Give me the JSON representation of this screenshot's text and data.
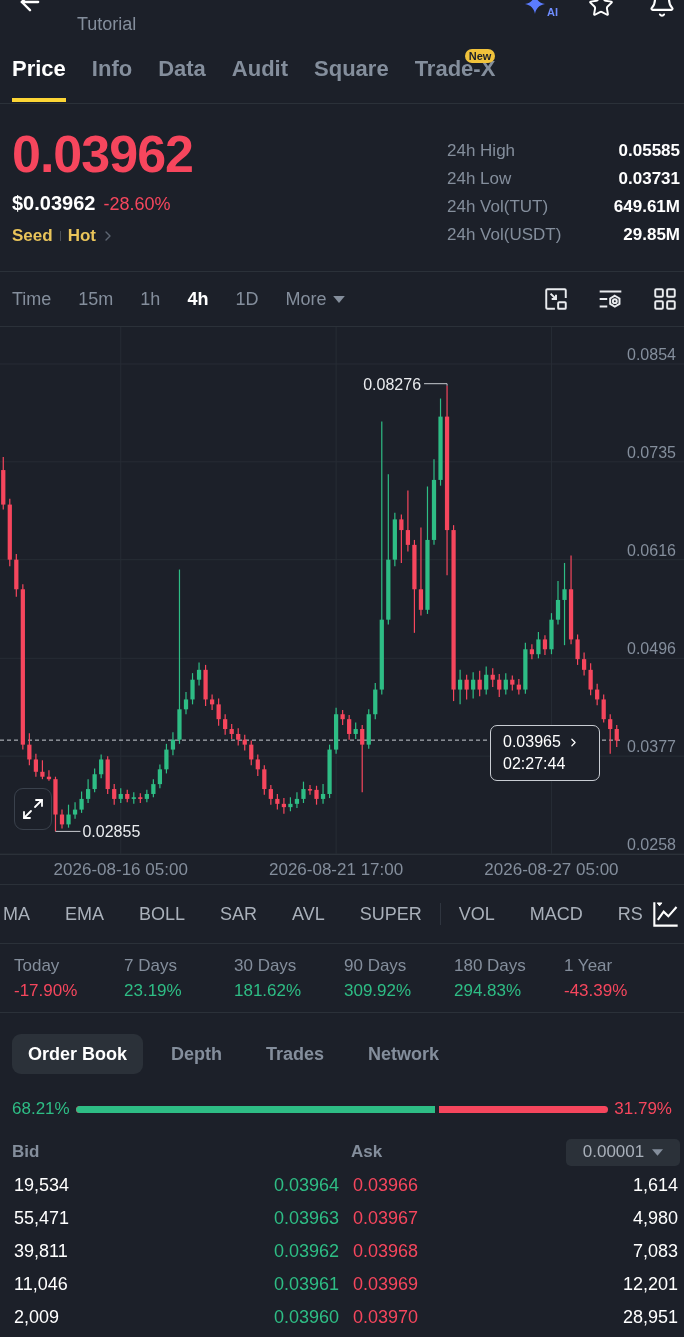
{
  "header": {
    "subtitle": "Tutorial",
    "ai_badge": "AI"
  },
  "tabs": [
    {
      "label": "Price",
      "selected": true
    },
    {
      "label": "Info",
      "selected": false
    },
    {
      "label": "Data",
      "selected": false
    },
    {
      "label": "Audit",
      "selected": false
    },
    {
      "label": "Square",
      "selected": false
    },
    {
      "label": "Trade-X",
      "selected": false,
      "badge": "New"
    }
  ],
  "price": {
    "last": "0.03962",
    "usd": "$0.03962",
    "change": "-28.60%",
    "tags": [
      "Seed",
      "Hot"
    ]
  },
  "stats": [
    {
      "label": "24h High",
      "value": "0.05585"
    },
    {
      "label": "24h Low",
      "value": "0.03731"
    },
    {
      "label": "24h Vol(TUT)",
      "value": "649.61M"
    },
    {
      "label": "24h Vol(USDT)",
      "value": "29.85M"
    }
  ],
  "intervals": [
    {
      "label": "Time",
      "selected": false,
      "kind": "option"
    },
    {
      "label": "15m",
      "selected": false,
      "kind": "option"
    },
    {
      "label": "1h",
      "selected": false,
      "kind": "option"
    },
    {
      "label": "4h",
      "selected": true,
      "kind": "option"
    },
    {
      "label": "1D",
      "selected": false,
      "kind": "option"
    },
    {
      "label": "More",
      "selected": false,
      "kind": "dropdown"
    }
  ],
  "chart": {
    "chart_data": {
      "type": "candlestick",
      "categories": [
        null,
        null,
        null,
        null,
        null,
        null,
        null,
        null,
        null,
        null,
        null,
        null,
        null,
        null,
        null,
        null,
        null,
        null,
        "2026-08-16 05:00",
        null,
        null,
        null,
        null,
        null,
        null,
        null,
        null,
        null,
        null,
        null,
        null,
        null,
        null,
        null,
        null,
        null,
        null,
        null,
        null,
        null,
        null,
        null,
        null,
        null,
        null,
        null,
        null,
        null,
        null,
        null,
        null,
        "2026-08-21 17:00",
        null,
        null,
        null,
        null,
        null,
        null,
        null,
        null,
        null,
        null,
        null,
        null,
        null,
        null,
        null,
        null,
        null,
        null,
        null,
        null,
        null,
        null,
        null,
        null,
        null,
        null,
        null,
        null,
        null,
        null,
        null,
        null,
        "2026-08-27 05:00",
        null,
        null,
        null,
        null,
        null,
        null,
        null,
        null,
        null,
        null
      ],
      "ohlc": [
        [
          0.0725,
          0.0741,
          0.0677,
          0.0683
        ],
        [
          0.0683,
          0.069,
          0.0608,
          0.0616
        ],
        [
          0.0616,
          0.0623,
          0.0571,
          0.058
        ],
        [
          0.058,
          0.0586,
          0.0385,
          0.0391
        ],
        [
          0.0391,
          0.0405,
          0.0366,
          0.0373
        ],
        [
          0.0373,
          0.038,
          0.0352,
          0.0358
        ],
        [
          0.0358,
          0.0372,
          0.0349,
          0.0352
        ],
        [
          0.0352,
          0.036,
          0.0347,
          0.0349
        ],
        [
          0.0349,
          0.0352,
          0.02855,
          0.0306
        ],
        [
          0.0306,
          0.0312,
          0.0289,
          0.0294
        ],
        [
          0.0294,
          0.0318,
          0.029,
          0.0306
        ],
        [
          0.0306,
          0.0321,
          0.0301,
          0.0312
        ],
        [
          0.0312,
          0.0334,
          0.0308,
          0.0325
        ],
        [
          0.0325,
          0.0349,
          0.032,
          0.0337
        ],
        [
          0.0337,
          0.0362,
          0.0333,
          0.0355
        ],
        [
          0.0355,
          0.0379,
          0.035,
          0.0373
        ],
        [
          0.0373,
          0.0377,
          0.0331,
          0.0337
        ],
        [
          0.0337,
          0.0343,
          0.0318,
          0.0325
        ],
        [
          0.0325,
          0.0338,
          0.032,
          0.0331
        ],
        [
          0.0331,
          0.0336,
          0.0321,
          0.0325
        ],
        [
          0.0325,
          0.0333,
          0.0319,
          0.0327
        ],
        [
          0.0327,
          0.0332,
          0.032,
          0.0325
        ],
        [
          0.0325,
          0.0336,
          0.0321,
          0.0331
        ],
        [
          0.0331,
          0.0349,
          0.0327,
          0.0343
        ],
        [
          0.0343,
          0.0367,
          0.0338,
          0.0361
        ],
        [
          0.0361,
          0.0392,
          0.0356,
          0.0385
        ],
        [
          0.0385,
          0.0406,
          0.0378,
          0.0397
        ],
        [
          0.0397,
          0.0604,
          0.0392,
          0.0434
        ],
        [
          0.0434,
          0.0455,
          0.0428,
          0.0446
        ],
        [
          0.0446,
          0.0478,
          0.044,
          0.047
        ],
        [
          0.047,
          0.0491,
          0.0463,
          0.0482
        ],
        [
          0.0482,
          0.0488,
          0.0438,
          0.0446
        ],
        [
          0.0446,
          0.0452,
          0.0433,
          0.044
        ],
        [
          0.044,
          0.0447,
          0.0414,
          0.0422
        ],
        [
          0.0422,
          0.0428,
          0.0403,
          0.041
        ],
        [
          0.041,
          0.0416,
          0.0398,
          0.0404
        ],
        [
          0.0404,
          0.0411,
          0.039,
          0.0397
        ],
        [
          0.0397,
          0.0403,
          0.0384,
          0.0391
        ],
        [
          0.0391,
          0.0396,
          0.0366,
          0.0373
        ],
        [
          0.0373,
          0.0379,
          0.0353,
          0.0361
        ],
        [
          0.0361,
          0.0366,
          0.033,
          0.0337
        ],
        [
          0.0337,
          0.0342,
          0.0318,
          0.0325
        ],
        [
          0.0325,
          0.0331,
          0.0312,
          0.0319
        ],
        [
          0.0319,
          0.0326,
          0.0307,
          0.0315
        ],
        [
          0.0315,
          0.0327,
          0.031,
          0.0319
        ],
        [
          0.0319,
          0.0333,
          0.0314,
          0.0325
        ],
        [
          0.0325,
          0.0346,
          0.032,
          0.0337
        ],
        [
          0.0337,
          0.0342,
          0.033,
          0.0336
        ],
        [
          0.0336,
          0.0341,
          0.0318,
          0.0325
        ],
        [
          0.0325,
          0.0343,
          0.0319,
          0.0331
        ],
        [
          0.0331,
          0.0391,
          0.0326,
          0.0385
        ],
        [
          0.0385,
          0.0436,
          0.038,
          0.0428
        ],
        [
          0.0428,
          0.0433,
          0.0415,
          0.0422
        ],
        [
          0.0422,
          0.0427,
          0.0397,
          0.0404
        ],
        [
          0.0404,
          0.0418,
          0.0398,
          0.041
        ],
        [
          0.041,
          0.0415,
          0.0333,
          0.0391
        ],
        [
          0.0391,
          0.0434,
          0.0386,
          0.0428
        ],
        [
          0.0428,
          0.0466,
          0.0422,
          0.0458
        ],
        [
          0.0458,
          0.0784,
          0.0452,
          0.0543
        ],
        [
          0.0543,
          0.072,
          0.0537,
          0.0616
        ],
        [
          0.0616,
          0.0673,
          0.0608,
          0.0665
        ],
        [
          0.0665,
          0.0671,
          0.0612,
          0.0652
        ],
        [
          0.0652,
          0.07,
          0.0626,
          0.0634
        ],
        [
          0.0634,
          0.064,
          0.0527,
          0.058
        ],
        [
          0.058,
          0.0655,
          0.0548,
          0.0555
        ],
        [
          0.0555,
          0.0705,
          0.055,
          0.064
        ],
        [
          0.064,
          0.0738,
          0.0634,
          0.0713
        ],
        [
          0.0713,
          0.0812,
          0.0706,
          0.079
        ],
        [
          0.079,
          0.08276,
          0.0597,
          0.0652
        ],
        [
          0.0652,
          0.0658,
          0.0444,
          0.0458
        ],
        [
          0.0458,
          0.0482,
          0.044,
          0.047
        ],
        [
          0.047,
          0.0476,
          0.0446,
          0.0458
        ],
        [
          0.0458,
          0.0479,
          0.0447,
          0.047
        ],
        [
          0.047,
          0.0481,
          0.045,
          0.0458
        ],
        [
          0.0458,
          0.0486,
          0.0452,
          0.0476
        ],
        [
          0.0476,
          0.0484,
          0.0461,
          0.047
        ],
        [
          0.047,
          0.0477,
          0.0449,
          0.0458
        ],
        [
          0.0458,
          0.0478,
          0.0452,
          0.047
        ],
        [
          0.047,
          0.0475,
          0.0457,
          0.0464
        ],
        [
          0.0464,
          0.0471,
          0.0452,
          0.0458
        ],
        [
          0.0458,
          0.0515,
          0.0453,
          0.0507
        ],
        [
          0.0507,
          0.0513,
          0.0495,
          0.0501
        ],
        [
          0.0501,
          0.0528,
          0.0496,
          0.0519
        ],
        [
          0.0519,
          0.0524,
          0.05,
          0.0507
        ],
        [
          0.0507,
          0.0551,
          0.0501,
          0.0543
        ],
        [
          0.0543,
          0.059,
          0.0537,
          0.0567
        ],
        [
          0.0567,
          0.0612,
          0.0512,
          0.058
        ],
        [
          0.058,
          0.0621,
          0.0513,
          0.0519
        ],
        [
          0.0519,
          0.0525,
          0.0488,
          0.0495
        ],
        [
          0.0495,
          0.0503,
          0.0475,
          0.0482
        ],
        [
          0.0482,
          0.049,
          0.0451,
          0.0458
        ],
        [
          0.0458,
          0.0465,
          0.0439,
          0.0446
        ],
        [
          0.0446,
          0.0452,
          0.0418,
          0.0422
        ],
        [
          0.0422,
          0.0428,
          0.038,
          0.041
        ],
        [
          0.041,
          0.0415,
          0.0388,
          0.0396
        ]
      ],
      "ylim": [
        0.0258,
        0.0899
      ],
      "yticks": [
        {
          "value": 0.0258,
          "label": "0.0258"
        },
        {
          "value": 0.0377,
          "label": "0.0377"
        },
        {
          "value": 0.0496,
          "label": "0.0496"
        },
        {
          "value": 0.0616,
          "label": "0.0616"
        },
        {
          "value": 0.0735,
          "label": "0.0735"
        },
        {
          "value": 0.0854,
          "label": "0.0854"
        }
      ],
      "grid": true,
      "ref_lines": [
        {
          "axis": "y",
          "value": 0.03965,
          "label": "0.03965"
        }
      ]
    },
    "high_marker": "0.08276",
    "low_marker": "0.02855",
    "countdown": "02:27:44"
  },
  "indicators": {
    "main": [
      "MA",
      "EMA",
      "BOLL",
      "SAR",
      "AVL",
      "SUPER"
    ],
    "sub": [
      "VOL",
      "MACD",
      "RS"
    ]
  },
  "periods": [
    {
      "label": "Today",
      "value": "-17.90%",
      "color": "#f6465d"
    },
    {
      "label": "7 Days",
      "value": "23.19%",
      "color": "#2ebd85"
    },
    {
      "label": "30 Days",
      "value": "181.62%",
      "color": "#2ebd85"
    },
    {
      "label": "90 Days",
      "value": "309.92%",
      "color": "#2ebd85"
    },
    {
      "label": "180 Days",
      "value": "294.83%",
      "color": "#2ebd85"
    },
    {
      "label": "1 Year",
      "value": "-43.39%",
      "color": "#f6465d"
    }
  ],
  "order_book": {
    "tabs": [
      {
        "label": "Order Book",
        "selected": true
      },
      {
        "label": "Depth",
        "selected": false
      },
      {
        "label": "Trades",
        "selected": false
      },
      {
        "label": "Network",
        "selected": false
      }
    ],
    "bid_ratio": "68.21%",
    "ask_ratio": "31.79%",
    "ratio_bar": {
      "level": 0.6821
    },
    "bid_label": "Bid",
    "ask_label": "Ask",
    "precision": "0.00001",
    "rows": [
      {
        "bid_qty": "19,534",
        "bid_price": "0.03964",
        "ask_price": "0.03966",
        "ask_qty": "1,614"
      },
      {
        "bid_qty": "55,471",
        "bid_price": "0.03963",
        "ask_price": "0.03967",
        "ask_qty": "4,980"
      },
      {
        "bid_qty": "39,811",
        "bid_price": "0.03962",
        "ask_price": "0.03968",
        "ask_qty": "7,083"
      },
      {
        "bid_qty": "11,046",
        "bid_price": "0.03961",
        "ask_price": "0.03969",
        "ask_qty": "12,201"
      },
      {
        "bid_qty": "2,009",
        "bid_price": "0.03960",
        "ask_price": "0.03970",
        "ask_qty": "28,951"
      }
    ]
  }
}
